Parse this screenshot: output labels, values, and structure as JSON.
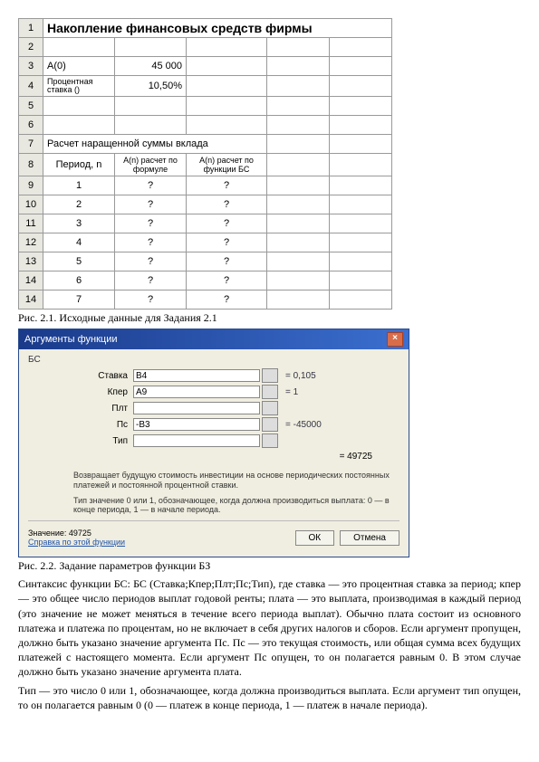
{
  "sheet": {
    "title": "Накопление финансовых средств фирмы",
    "a0_label": "A(0)",
    "a0_value": "45 000",
    "rate_label": "Процентная ставка ()",
    "rate_value": "10,50%",
    "calc_title": "Расчет наращенной суммы вклада",
    "col_period": "Период, n",
    "col_formula": "A(n) расчет по формуле",
    "col_bs": "A(n) расчет по функции БС",
    "rows": [
      {
        "n": "1",
        "f": "?",
        "b": "?"
      },
      {
        "n": "2",
        "f": "?",
        "b": "?"
      },
      {
        "n": "3",
        "f": "?",
        "b": "?"
      },
      {
        "n": "4",
        "f": "?",
        "b": "?"
      },
      {
        "n": "5",
        "f": "?",
        "b": "?"
      },
      {
        "n": "6",
        "f": "?",
        "b": "?"
      },
      {
        "n": "7",
        "f": "?",
        "b": "?"
      }
    ],
    "row_nums": [
      "1",
      "2",
      "3",
      "4",
      "5",
      "6",
      "7",
      "8",
      "9",
      "10",
      "11",
      "12",
      "13",
      "14"
    ]
  },
  "caption1": "Рис. 2.1. Исходные данные для Задания 2.1",
  "dialog": {
    "title": "Аргументы функции",
    "fn": "БС",
    "args": [
      {
        "label": "Ставка",
        "value": "B4",
        "result": "= 0,105"
      },
      {
        "label": "Кпер",
        "value": "A9",
        "result": "= 1"
      },
      {
        "label": "Плт",
        "value": "",
        "result": ""
      },
      {
        "label": "Пс",
        "value": "-B3",
        "result": "= -45000"
      },
      {
        "label": "Тип",
        "value": "",
        "result": ""
      }
    ],
    "value_line": "= 49725",
    "desc1": "Возвращает будущую стоимость инвестиции на основе периодических постоянных платежей и постоянной процентной ставки.",
    "desc2": "Тип  значение 0 или 1, обозначающее, когда должна производиться выплата: 0 — в конце периода, 1 — в начале периода.",
    "result_label": "Значение: 49725",
    "help": "Справка по этой функции",
    "ok": "ОК",
    "cancel": "Отмена"
  },
  "caption2": "Рис. 2.2. Задание параметров функции БЗ",
  "para1": "Синтаксис функции БС: БС (Ставка;Кпер;Плт;Пс;Тип), где ставка — это процентная ставка за период; кпер — это общее число периодов выплат годовой ренты; плата — это выплата, производимая в каждый период (это значение не может меняться в течение всего периода выплат). Обычно плата состоит из основного платежа и платежа по процентам, но не включает в себя других налогов и сборов. Если аргумент пропущен, должно быть указано значение аргумента Пс. Пс — это текущая стоимость, или общая сумма всех будущих платежей с настоящего момента. Если аргумент Пс опущен, то он полагается равным 0. В этом случае должно быть указано значение аргумента плата.",
  "para2": "Тип — это число 0 или 1, обозначающее, когда должна производиться выплата. Если аргумент тип опущен, то он полагается равным 0 (0 — платеж в конце периода, 1 — платеж в начале периода).",
  "chart_data": {
    "type": "table",
    "title": "Накопление финансовых средств фирмы",
    "a0": 45000,
    "rate_percent": 10.5,
    "columns": [
      "Период, n",
      "A(n) расчет по формуле",
      "A(n) расчет по функции БС"
    ],
    "periods": [
      1,
      2,
      3,
      4,
      5,
      6,
      7
    ],
    "values_formula": [
      null,
      null,
      null,
      null,
      null,
      null,
      null
    ],
    "values_bs": [
      null,
      null,
      null,
      null,
      null,
      null,
      null
    ]
  }
}
